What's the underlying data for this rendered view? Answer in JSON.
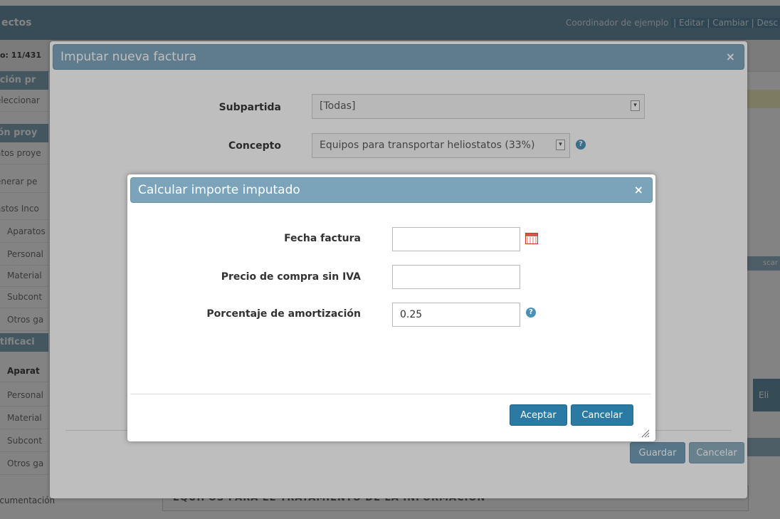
{
  "background": {
    "header_title": "ectos",
    "user_text": "Coordinador de ejemplo",
    "user_links": "| Editar | Cambiar | Desc",
    "counter": "o: 11/431",
    "sidebar": [
      {
        "label": "cción pr",
        "type": "section"
      },
      {
        "label": "eleccionar",
        "type": "item"
      },
      {
        "label": "ión proy",
        "type": "section"
      },
      {
        "label": "atos proye",
        "type": "item"
      },
      {
        "label": "enerar pe",
        "type": "item"
      },
      {
        "label": "astos Inco",
        "type": "item"
      },
      {
        "label": "Aparatos",
        "type": "indent"
      },
      {
        "label": "Personal",
        "type": "indent"
      },
      {
        "label": "Material",
        "type": "indent"
      },
      {
        "label": "Subcont",
        "type": "indent"
      },
      {
        "label": "Otros ga",
        "type": "indent"
      },
      {
        "label": "stificaci",
        "type": "section"
      },
      {
        "label": "Aparat",
        "type": "indent-bold"
      },
      {
        "label": "Personal",
        "type": "indent"
      },
      {
        "label": "Material",
        "type": "indent"
      },
      {
        "label": "Subcont",
        "type": "indent"
      },
      {
        "label": "Otros ga",
        "type": "indent"
      }
    ],
    "right_blue_text": "scar",
    "right_blue2_text": "Eli",
    "documentation": "ocumentación",
    "bottom_title": "EQUIPOS PARA EL TRATAMIENTO DE LA INFORMACION"
  },
  "outer_dialog": {
    "title": "Imputar nueva factura",
    "close_icon": "×",
    "subpartida_label": "Subpartida",
    "subpartida_value": "[Todas]",
    "concepto_label": "Concepto",
    "concepto_value": "Equipos para transportar heliostatos (33%)",
    "help_icon": "?",
    "save_label": "Guardar",
    "cancel_label": "Cancelar"
  },
  "inner_dialog": {
    "title": "Calcular importe imputado",
    "close_icon": "×",
    "fecha_label": "Fecha factura",
    "fecha_value": "",
    "precio_label": "Precio de compra sin IVA",
    "precio_value": "",
    "porcentaje_label": "Porcentaje de amortización",
    "porcentaje_value": "0.25",
    "help_icon": "?",
    "accept_label": "Aceptar",
    "cancel_label": "Cancelar"
  },
  "colors": {
    "accent": "#2a7aa3",
    "titlebar": "#7ba4bb",
    "header": "#5f8aa0"
  }
}
